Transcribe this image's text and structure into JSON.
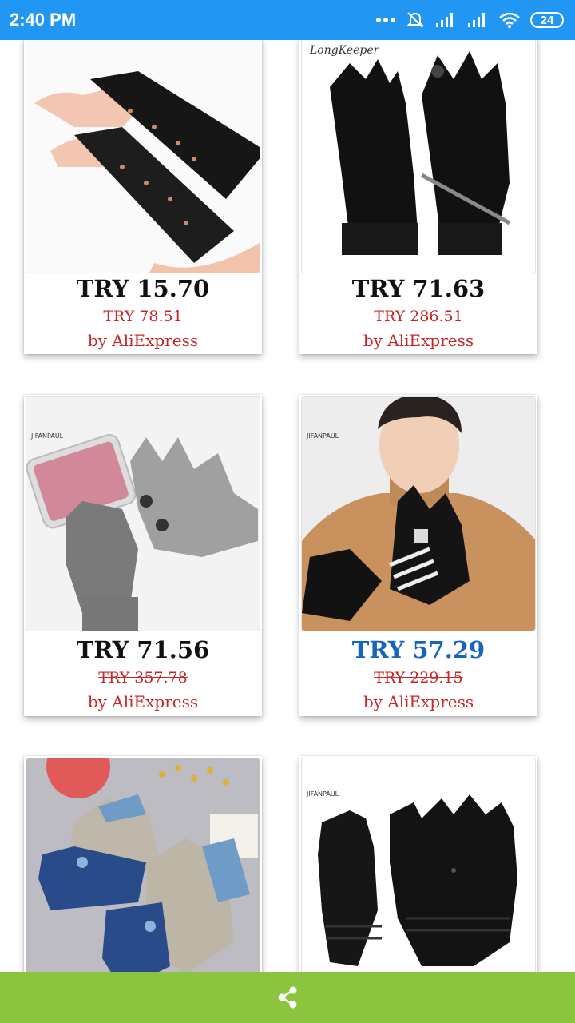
{
  "status_bar": {
    "time": "2:40 PM",
    "battery": "24"
  },
  "products": [
    {
      "price": "TRY 15.70",
      "old_price": "TRY 78.51",
      "seller": "by AliExpress",
      "image": "black fingerless knit arm warmers"
    },
    {
      "price": "TRY 71.63",
      "old_price": "TRY 286.51",
      "seller": "by AliExpress",
      "image": "black touchscreen sport gloves",
      "brand_text": "LongKeeper"
    },
    {
      "price": "TRY 71.56",
      "old_price": "TRY 357.78",
      "seller": "by AliExpress",
      "image": "grey knit touchscreen gloves with phone",
      "brand_text": "JIFANPAUL"
    },
    {
      "price": "TRY 57.29",
      "old_price": "TRY 229.15",
      "seller": "by AliExpress",
      "image": "man wearing black striped gloves",
      "brand_text": "JIFANPAUL",
      "price_color": "#1565c0"
    },
    {
      "image": "blue and grey convertible mitten gloves"
    },
    {
      "image": "black convertible knit mitten gloves",
      "brand_text": "JIFANPAUL"
    }
  ],
  "bottom_bar": {
    "icon": "share-icon",
    "color": "#8bc53f"
  },
  "colors": {
    "status_bar": "#2196f3",
    "old_price": "#c62828",
    "seller": "#c62828"
  }
}
